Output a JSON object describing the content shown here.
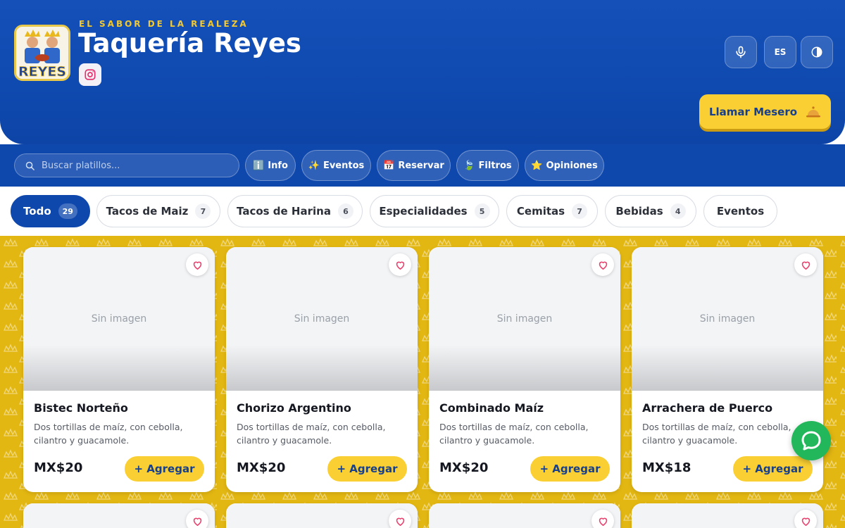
{
  "header": {
    "tagline": "EL SABOR DE LA REALEZA",
    "title": "Taquería Reyes",
    "logo_text": "REYES",
    "language": "ES",
    "call_waiter": "Llamar Mesero",
    "brand_color": "#0f48ad",
    "accent_color": "#f9cf33",
    "icons": {
      "instagram": "instagram-icon",
      "mic": "microphone-icon",
      "theme": "contrast-icon",
      "bell": "service-bell-icon"
    }
  },
  "toolbar": {
    "search_placeholder": "Buscar platillos...",
    "buttons": [
      {
        "icon": "ℹ️",
        "label": "Info"
      },
      {
        "icon": "✨",
        "label": "Eventos"
      },
      {
        "icon": "📅",
        "label": "Reservar"
      },
      {
        "icon": "🍃",
        "label": "Filtros"
      },
      {
        "icon": "⭐",
        "label": "Opiniones"
      }
    ]
  },
  "categories": [
    {
      "label": "Todo",
      "count": "29",
      "active": true
    },
    {
      "label": "Tacos de Maiz",
      "count": "7"
    },
    {
      "label": "Tacos de Harina",
      "count": "6"
    },
    {
      "label": "Especialidades",
      "count": "5"
    },
    {
      "label": "Cemitas",
      "count": "7"
    },
    {
      "label": "Bebidas",
      "count": "4"
    },
    {
      "label": "Eventos",
      "count": ""
    }
  ],
  "products": [
    {
      "image_label": "Sin imagen",
      "name": "Bistec Norteño",
      "description": "Dos tortillas de maíz, con cebolla, cilantro y guacamole.",
      "price": "MX$20",
      "add_label": "+ Agregar"
    },
    {
      "image_label": "Sin imagen",
      "name": "Chorizo Argentino",
      "description": "Dos tortillas de maíz, con cebolla, cilantro y guacamole.",
      "price": "MX$20",
      "add_label": "+ Agregar"
    },
    {
      "image_label": "Sin imagen",
      "name": "Combinado Maíz",
      "description": "Dos tortillas de maíz, con cebolla, cilantro y guacamole.",
      "price": "MX$20",
      "add_label": "+ Agregar"
    },
    {
      "image_label": "Sin imagen",
      "name": "Arrachera de Puerco",
      "description": "Dos tortillas de maíz, con cebolla, cilantro y guacamole.",
      "price": "MX$18",
      "add_label": "+ Agregar"
    }
  ]
}
